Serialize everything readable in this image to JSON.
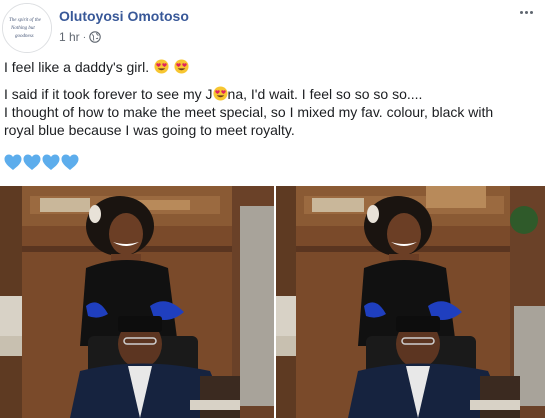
{
  "post": {
    "author": "Olutoyosi Omotoso",
    "time": "1 hr",
    "dot": "·",
    "privacy_icon": "globe-icon",
    "more_icon": "more-options-icon",
    "line1": "I feel like a daddy's girl.",
    "line2_before": "I said if it took forever to see my J",
    "line2_after": "na, I'd wait. I feel so so so so....",
    "line3": "I thought of how to make the meet special, so I mixed my fav. colour, black with",
    "line4": "royal blue because I was going to meet royalty.",
    "emoji_heart_eyes": "heart-eyes-emoji",
    "blue_heart_count": 4
  },
  "avatar": {
    "text_lines": [
      "The spirit of the",
      "Nothing but",
      "goodness"
    ]
  },
  "colors": {
    "author_link": "#385898",
    "meta_gray": "#606770",
    "blue_heart": "#5dadec",
    "blouse_blue": "#1f3fbf"
  }
}
